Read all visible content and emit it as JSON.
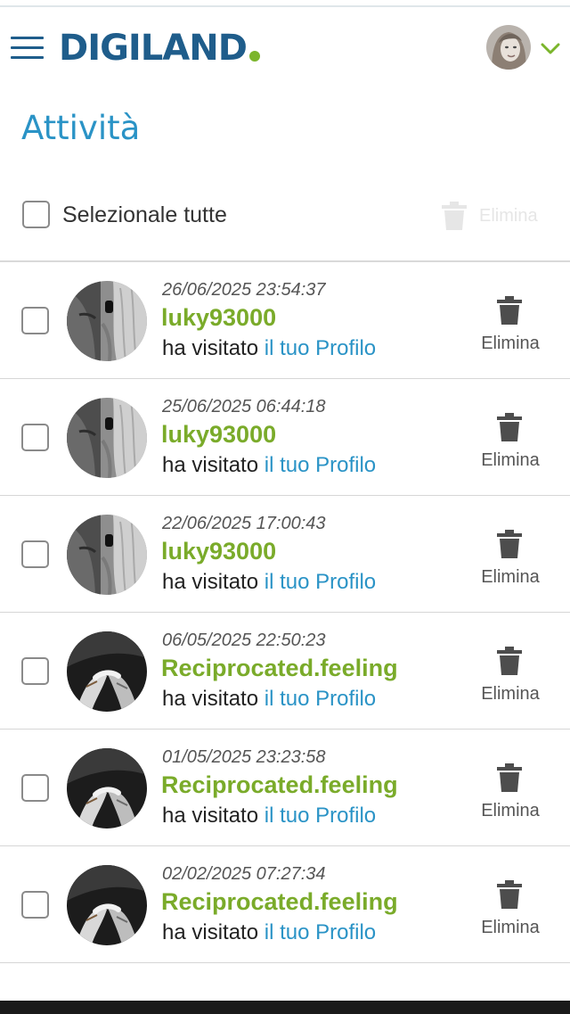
{
  "header": {
    "logo_text": "DIGILAND",
    "menu_icon": "hamburger-menu-icon",
    "dropdown_icon": "chevron-down-icon",
    "brand_colors": {
      "primary": "#1f5d8b",
      "accent": "#7bb52c",
      "link": "#2a93c6"
    }
  },
  "page": {
    "title": "Attività"
  },
  "toolbar": {
    "select_all_label": "Selezionale tutte",
    "delete_label": "Elimina",
    "delete_icon": "trash-icon"
  },
  "activities": [
    {
      "date": "26/06/2025 23:54:37",
      "user": "luky93000",
      "action": "ha visitato",
      "target": "il tuo Profilo",
      "delete_label": "Elimina",
      "avatar": "avatar-face-hand"
    },
    {
      "date": "25/06/2025 06:44:18",
      "user": "luky93000",
      "action": "ha visitato",
      "target": "il tuo Profilo",
      "delete_label": "Elimina",
      "avatar": "avatar-face-hand"
    },
    {
      "date": "22/06/2025 17:00:43",
      "user": "luky93000",
      "action": "ha visitato",
      "target": "il tuo Profilo",
      "delete_label": "Elimina",
      "avatar": "avatar-face-hand"
    },
    {
      "date": "06/05/2025 22:50:23",
      "user": "Reciprocated.feeling",
      "action": "ha visitato",
      "target": "il tuo Profilo",
      "delete_label": "Elimina",
      "avatar": "avatar-holding-hands"
    },
    {
      "date": "01/05/2025 23:23:58",
      "user": "Reciprocated.feeling",
      "action": "ha visitato",
      "target": "il tuo Profilo",
      "delete_label": "Elimina",
      "avatar": "avatar-holding-hands"
    },
    {
      "date": "02/02/2025 07:27:34",
      "user": "Reciprocated.feeling",
      "action": "ha visitato",
      "target": "il tuo Profilo",
      "delete_label": "Elimina",
      "avatar": "avatar-holding-hands"
    }
  ]
}
